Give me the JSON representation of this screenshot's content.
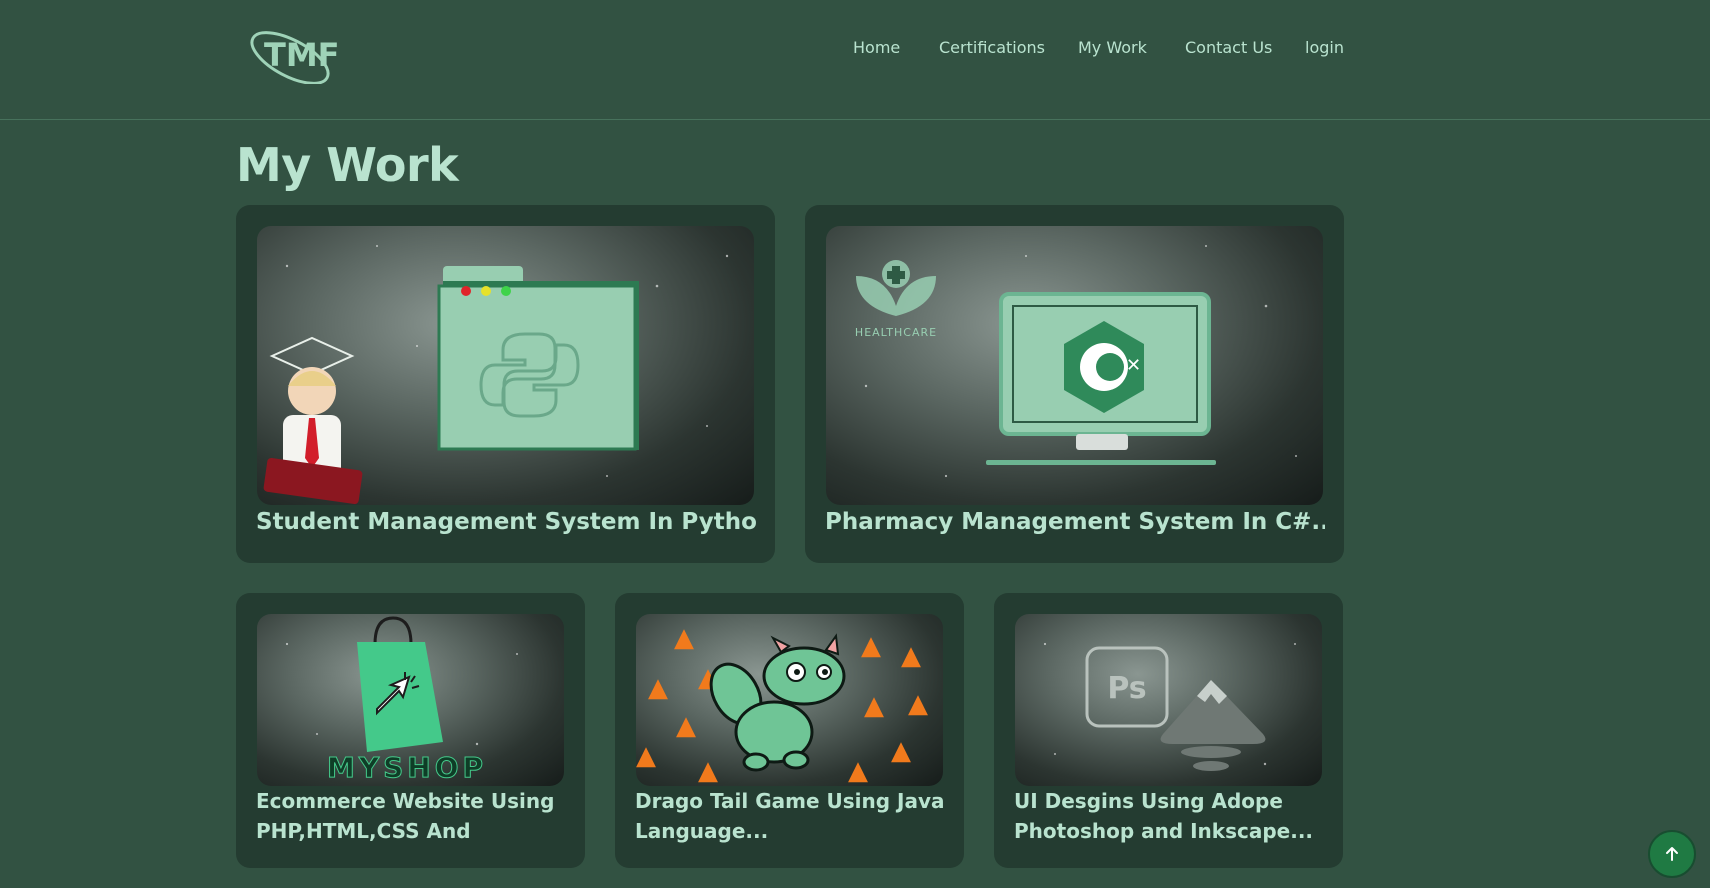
{
  "header": {
    "logo_text": "TMF",
    "nav": [
      {
        "label": "Home"
      },
      {
        "label": "Certifications"
      },
      {
        "label": "My Work"
      },
      {
        "label": "Contact Us"
      },
      {
        "label": "login"
      }
    ]
  },
  "main": {
    "title": "My Work",
    "projects": [
      {
        "title": "Student Management System In Python..",
        "icon": "python-folder-illustration"
      },
      {
        "title": "Pharmacy Management System In C#...",
        "icon": "csharp-monitor-illustration",
        "badge_text": "HEALTHCARE"
      },
      {
        "title": "Ecommerce Website Using PHP,HTML,CSS And MySql...",
        "icon": "shopping-bag-illustration",
        "badge_text": "MYSHOP"
      },
      {
        "title": "Drago Tail Game Using Java Language...",
        "icon": "dragon-illustration"
      },
      {
        "title": "UI Desgins Using Adope Photoshop and Inkscape...",
        "icon": "photoshop-inkscape-illustration",
        "badge_text": "Ps"
      }
    ]
  },
  "colors": {
    "background": "#325242",
    "card": "#243c31",
    "accent_text": "#b9e3cf",
    "mint": "#98ceb1",
    "scroll_button": "#1f7a43"
  }
}
